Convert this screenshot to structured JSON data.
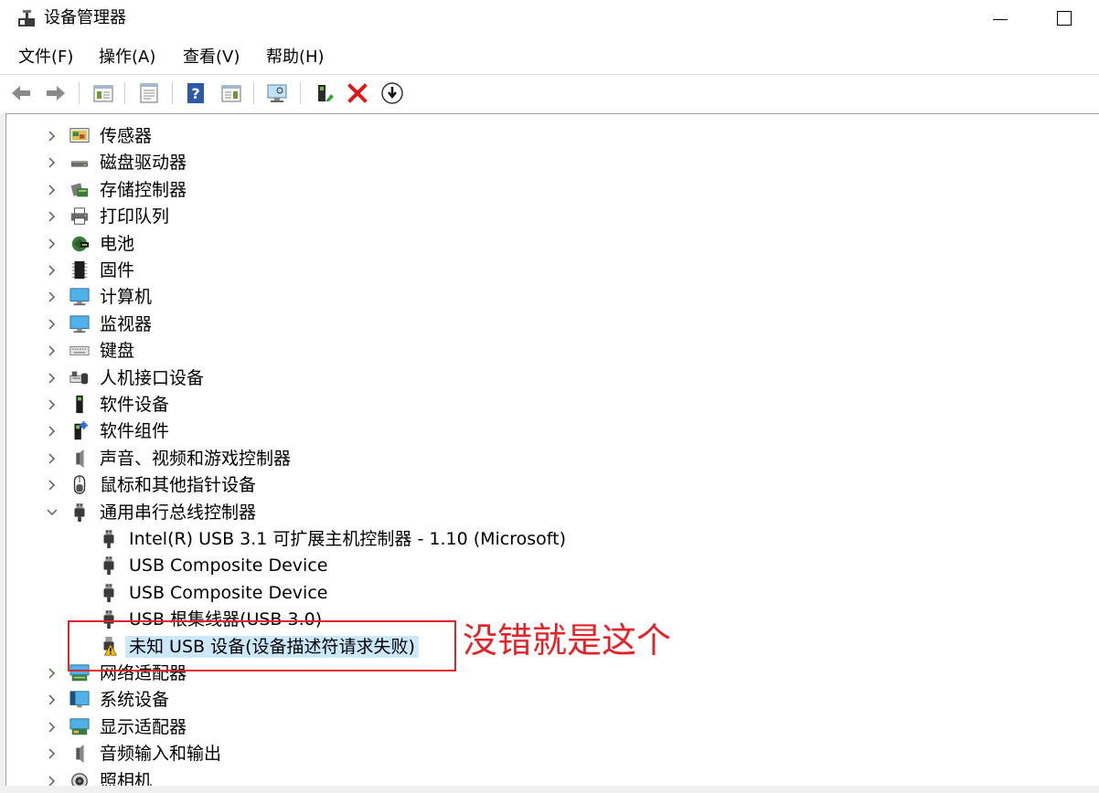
{
  "window": {
    "title": "设备管理器"
  },
  "menu": {
    "items": [
      "文件(F)",
      "操作(A)",
      "查看(V)",
      "帮助(H)"
    ]
  },
  "toolbar": {
    "icons": [
      "back-arrow-icon",
      "forward-arrow-icon",
      "show-hide-tree-icon",
      "properties-icon",
      "help-icon",
      "action-pane-icon",
      "scan-hardware-icon",
      "update-driver-icon",
      "uninstall-device-icon",
      "disable-device-icon"
    ]
  },
  "tree": {
    "categories": [
      {
        "label": "传感器",
        "icon": "sensor-icon",
        "expanded": false
      },
      {
        "label": "磁盘驱动器",
        "icon": "disk-drive-icon",
        "expanded": false
      },
      {
        "label": "存储控制器",
        "icon": "storage-controller-icon",
        "expanded": false
      },
      {
        "label": "打印队列",
        "icon": "printer-icon",
        "expanded": false
      },
      {
        "label": "电池",
        "icon": "battery-icon",
        "expanded": false
      },
      {
        "label": "固件",
        "icon": "firmware-icon",
        "expanded": false
      },
      {
        "label": "计算机",
        "icon": "computer-icon",
        "expanded": false
      },
      {
        "label": "监视器",
        "icon": "monitor-icon",
        "expanded": false
      },
      {
        "label": "键盘",
        "icon": "keyboard-icon",
        "expanded": false
      },
      {
        "label": "人机接口设备",
        "icon": "hid-icon",
        "expanded": false
      },
      {
        "label": "软件设备",
        "icon": "software-device-icon",
        "expanded": false
      },
      {
        "label": "软件组件",
        "icon": "software-component-icon",
        "expanded": false
      },
      {
        "label": "声音、视频和游戏控制器",
        "icon": "speaker-icon",
        "expanded": false
      },
      {
        "label": "鼠标和其他指针设备",
        "icon": "mouse-icon",
        "expanded": false
      },
      {
        "label": "通用串行总线控制器",
        "icon": "usb-plug-icon",
        "expanded": true
      }
    ],
    "usb_children": [
      {
        "label": "Intel(R) USB 3.1 可扩展主机控制器 - 1.10 (Microsoft)",
        "icon": "usb-plug-icon"
      },
      {
        "label": "USB Composite Device",
        "icon": "usb-plug-icon"
      },
      {
        "label": "USB Composite Device",
        "icon": "usb-plug-icon"
      },
      {
        "label": "USB 根集线器(USB 3.0)",
        "icon": "usb-plug-icon"
      },
      {
        "label": "未知 USB 设备(设备描述符请求失败)",
        "icon": "warning-usb-icon",
        "selected": true
      }
    ],
    "after": [
      {
        "label": "网络适配器",
        "icon": "network-adapter-icon",
        "expanded": false
      },
      {
        "label": "系统设备",
        "icon": "system-device-icon",
        "expanded": false
      },
      {
        "label": "显示适配器",
        "icon": "display-adapter-icon",
        "expanded": false
      },
      {
        "label": "音频输入和输出",
        "icon": "speaker-icon",
        "expanded": false
      },
      {
        "label": "照相机",
        "icon": "camera-icon",
        "expanded": false
      }
    ]
  },
  "annotation": {
    "text": "没错就是这个",
    "color": "#e0242a"
  },
  "colors": {
    "selection": "#cce8ff",
    "warning": "#f5c400"
  }
}
